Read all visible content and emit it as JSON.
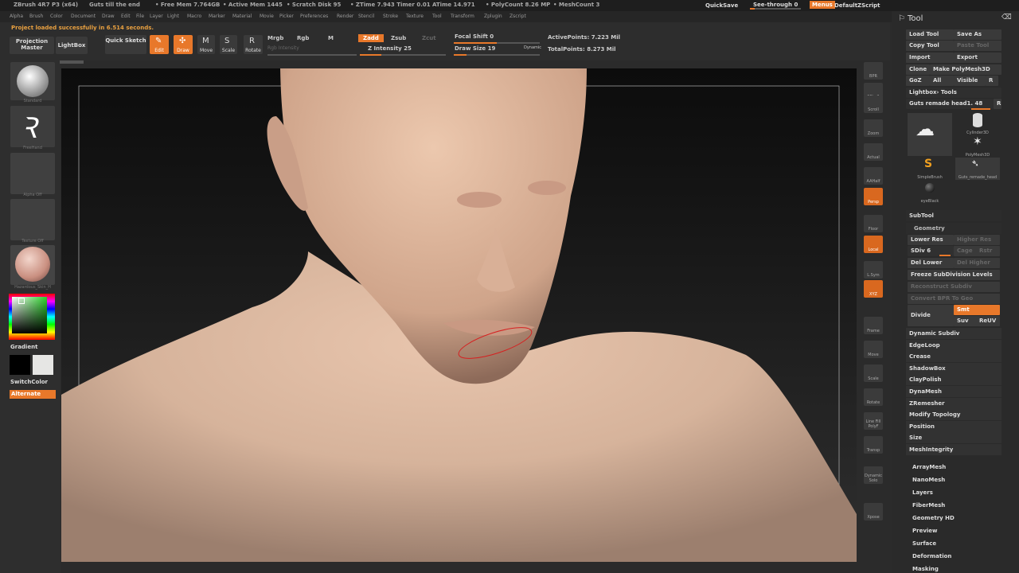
{
  "title_bar": {
    "app": "ZBrush 4R7 P3 (x64)",
    "project": "Guts till the end",
    "free_mem": "• Free Mem 7.764GB",
    "active_mem": "• Active Mem 1445",
    "scratch": "• Scratch Disk 95",
    "ztime": "• ZTime 7.943 Timer 0.01 ATime 14.971",
    "polycount": "• PolyCount 8.26 MP",
    "meshcount": "• MeshCount 3",
    "quicksave": "QuickSave",
    "see_through": "See-through 0",
    "menus": "Menus",
    "default_script": "DefaultZScript"
  },
  "menu_bar": [
    "Alpha",
    "Brush",
    "Color",
    "Document",
    "Draw",
    "Edit",
    "File",
    "Layer",
    "Light",
    "Macro",
    "Marker",
    "Material",
    "Movie",
    "Picker",
    "Preferences",
    "Render",
    "Stencil",
    "Stroke",
    "Texture",
    "Tool",
    "Transform",
    "Zplugin",
    "Zscript"
  ],
  "status_message": "Project loaded successfully in 6.514 seconds.",
  "toolbar": {
    "projection_master": "Projection Master",
    "lightbox": "LightBox",
    "quick_sketch": "Quick Sketch",
    "edit": "Edit",
    "draw": "Draw",
    "move": "Move",
    "scale": "Scale",
    "rotate": "Rotate",
    "mrgb": "Mrgb",
    "rgb": "Rgb",
    "m": "M",
    "rgb_intensity": "Rgb Intensity",
    "zadd": "Zadd",
    "zsub": "Zsub",
    "zcut": "Zcut",
    "z_intensity": "Z Intensity 25",
    "focal_shift": "Focal Shift 0",
    "draw_size": "Draw Size 19",
    "dynamic": "Dynamic",
    "active_points": "ActivePoints: 7.223 Mil",
    "total_points": "TotalPoints: 8.273 Mil",
    "z_intensity_value": 0.25,
    "focal_shift_value": 0.5,
    "draw_size_value": 0.15
  },
  "left_shelf": {
    "brush_label": "Standard",
    "stroke_label": "FreeHand",
    "alpha_label": "Alpha Off",
    "texture_label": "Texture Off",
    "material_label": "Hazardous_Skin_H",
    "gradient": "Gradient",
    "switch_color": "SwitchColor",
    "alternate": "Alternate"
  },
  "right_shelf": [
    "BPR",
    "SPix 3",
    "Scroll",
    "Zoom",
    "Actual",
    "AAHalf",
    "Persp",
    "Floor",
    "Local",
    "L.Sym",
    "XYZ",
    "Frame",
    "Move",
    "Scale",
    "Rotate",
    "Line Fill PolyF",
    "Transp",
    "Dynamic Solo",
    "Xpose"
  ],
  "tool_panel": {
    "title": "Tool",
    "load_tool": "Load Tool",
    "save_as": "Save As",
    "copy_tool": "Copy Tool",
    "paste_tool": "Paste Tool",
    "import": "Import",
    "export": "Export",
    "clone": "Clone",
    "make_polymesh": "Make PolyMesh3D",
    "goz": "GoZ",
    "all": "All",
    "visible": "Visible",
    "r": "R",
    "lightbox_tools": "Lightbox› Tools",
    "current_tool": "Guts remade head1. 48",
    "tool_thumbs": [
      "Cylinder3D",
      "PolyMesh3D",
      "SimpleBrush",
      "Guts_remade_head",
      "eyeBlack"
    ],
    "subtool": "SubTool",
    "geometry": "Geometry",
    "lower_res": "Lower Res",
    "higher_res": "Higher Res",
    "sdiv": "SDiv 6",
    "cage": "Cage",
    "rstr": "Rstr",
    "del_lower": "Del Lower",
    "del_higher": "Del Higher",
    "freeze": "Freeze SubDivision Levels",
    "reconstruct": "Reconstruct Subdiv",
    "convert_bpr": "Convert BPR To Geo",
    "divide": "Divide",
    "smt": "Smt",
    "suv": "Suv",
    "reuv": "ReUV",
    "geometry_items": [
      "Dynamic Subdiv",
      "EdgeLoop",
      "Crease",
      "ShadowBox",
      "ClayPolish",
      "DynaMesh",
      "ZRemesher",
      "Modify Topology",
      "Position",
      "Size",
      "MeshIntegrity"
    ],
    "sections": [
      "ArrayMesh",
      "NanoMesh",
      "Layers",
      "FiberMesh",
      "Geometry HD",
      "Preview",
      "Surface",
      "Deformation",
      "Masking"
    ]
  },
  "colors": {
    "accent": "#e8782a",
    "skin": "#d9b49a",
    "background": "#2b2b2b"
  }
}
